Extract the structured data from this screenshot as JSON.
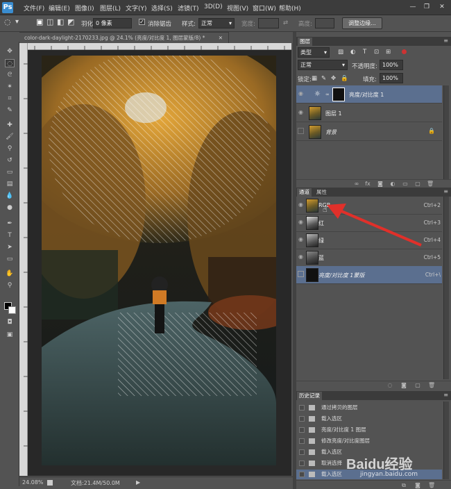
{
  "app": {
    "logo": "Ps"
  },
  "menubar": {
    "items": [
      "文件(F)",
      "编辑(E)",
      "图像(I)",
      "图层(L)",
      "文字(Y)",
      "选择(S)",
      "滤镜(T)",
      "3D(D)",
      "视图(V)",
      "窗口(W)",
      "帮助(H)"
    ],
    "window_controls": [
      "—",
      "❐",
      "✕"
    ]
  },
  "options_bar": {
    "feather_label": "羽化:",
    "feather_value": "0 像素",
    "antialias_label": "消除锯齿",
    "antialias_checked": true,
    "style_label": "样式:",
    "style_value": "正常",
    "width_label": "宽度:",
    "height_label": "高度:",
    "refine_edge_button": "调整边缘..."
  },
  "document": {
    "tab_title": "color-dark-daylight-2170233.jpg @ 24.1% (亮度/对比度 1, 图层蒙版/8) *",
    "tab_close": "✕",
    "zoom": "24.08%",
    "doc_info": "文档:21.4M/50.0M"
  },
  "layers_panel": {
    "tab": "图层",
    "filter_kind": "类型",
    "blend_mode": "正常",
    "opacity_label": "不透明度:",
    "opacity_value": "100%",
    "lock_label": "锁定:",
    "fill_label": "填充:",
    "fill_value": "100%",
    "layers": [
      {
        "name": "亮度/对比度 1",
        "selected": true,
        "visible": true
      },
      {
        "name": "图层 1",
        "selected": false,
        "visible": true
      },
      {
        "name": "背景",
        "selected": false,
        "visible": false,
        "locked": true
      }
    ]
  },
  "channels_panel": {
    "tabs": [
      "通道",
      "属性"
    ],
    "channels": [
      {
        "name": "RGB",
        "shortcut": "Ctrl+2"
      },
      {
        "name": "红",
        "shortcut": "Ctrl+3"
      },
      {
        "name": "绿",
        "shortcut": "Ctrl+4"
      },
      {
        "name": "蓝",
        "shortcut": "Ctrl+5"
      },
      {
        "name": "亮度/对比度 1蒙版",
        "shortcut": "Ctrl+\\"
      }
    ]
  },
  "history_panel": {
    "tab": "历史记录",
    "items": [
      "通过拷贝的图层",
      "载入选区",
      "亮度/对比度 1 图层",
      "修改亮度/对比度图层",
      "载入选区",
      "取消选择",
      "载入选区"
    ]
  },
  "watermark": {
    "brand": "Baidu经验",
    "url": "jingyan.baidu.com"
  },
  "colors": {
    "selection": "#5b6f8f",
    "arrow": "#e0302a",
    "panel_bg": "#535353"
  }
}
